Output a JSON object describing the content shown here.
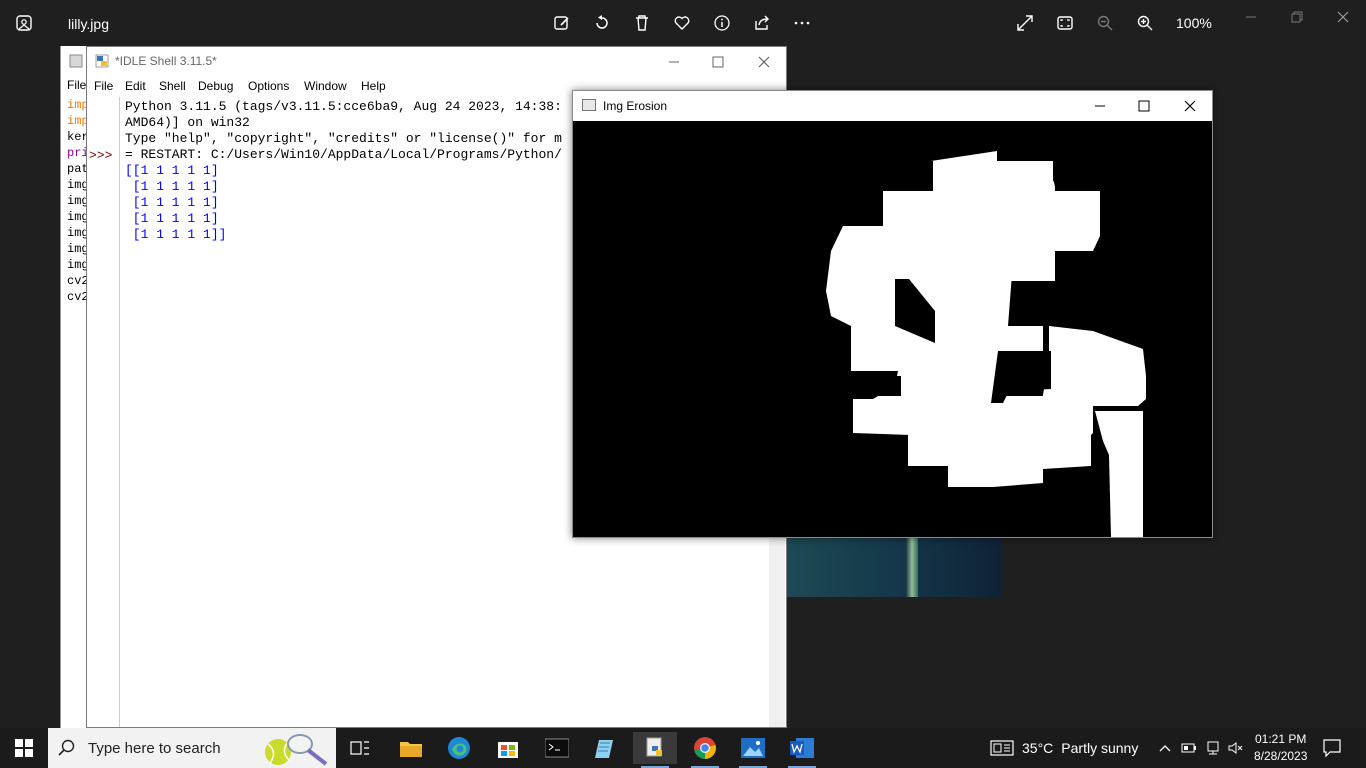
{
  "photos": {
    "file_name": "lilly.jpg",
    "zoom": "100%",
    "toolbar_icons": [
      "edit-icon",
      "rotate-icon",
      "delete-icon",
      "favorite-icon",
      "info-icon",
      "share-icon",
      "more-icon"
    ],
    "right_icons": [
      "fullscreen-icon",
      "fit-icon",
      "zoom-out-icon",
      "zoom-in-icon"
    ]
  },
  "editor_back": {
    "menu_fragment": "File",
    "code_fragments": [
      {
        "text": "imp",
        "color": "#ff7700"
      },
      {
        "text": "imp",
        "color": "#ff7700"
      },
      {
        "text": "ker",
        "color": "#000000"
      },
      {
        "text": "pri",
        "color": "#900090"
      },
      {
        "text": "pat",
        "color": "#000000"
      },
      {
        "text": "img",
        "color": "#000000"
      },
      {
        "text": "img",
        "color": "#000000"
      },
      {
        "text": "img",
        "color": "#000000"
      },
      {
        "text": "img",
        "color": "#000000"
      },
      {
        "text": "img",
        "color": "#000000"
      },
      {
        "text": "img",
        "color": "#000000"
      },
      {
        "text": "cv2",
        "color": "#000000"
      },
      {
        "text": "cv2",
        "color": "#000000"
      }
    ]
  },
  "idle": {
    "title": "*IDLE Shell 3.11.5*",
    "menu": [
      "File",
      "Edit",
      "Shell",
      "Debug",
      "Options",
      "Window",
      "Help"
    ],
    "prompt": ">>>",
    "lines": [
      "Python 3.11.5 (tags/v3.11.5:cce6ba9, Aug 24 2023, 14:38:",
      "AMD64)] on win32",
      "Type \"help\", \"copyright\", \"credits\" or \"license()\" for m",
      "",
      "= RESTART: C:/Users/Win10/AppData/Local/Programs/Python/"
    ],
    "output": [
      "[[1 1 1 1 1]",
      " [1 1 1 1 1]",
      " [1 1 1 1 1]",
      " [1 1 1 1 1]",
      " [1 1 1 1 1]]"
    ]
  },
  "erosion": {
    "title": "Img Erosion"
  },
  "taskbar": {
    "search_placeholder": "Type here to search",
    "apps": [
      "task-view",
      "file-explorer",
      "edge",
      "store",
      "terminal",
      "notepad",
      "python-idle",
      "chrome",
      "photos",
      "word"
    ],
    "weather_temp": "35°C",
    "weather_desc": "Partly sunny",
    "time": "01:21 PM",
    "date": "8/28/2023"
  }
}
